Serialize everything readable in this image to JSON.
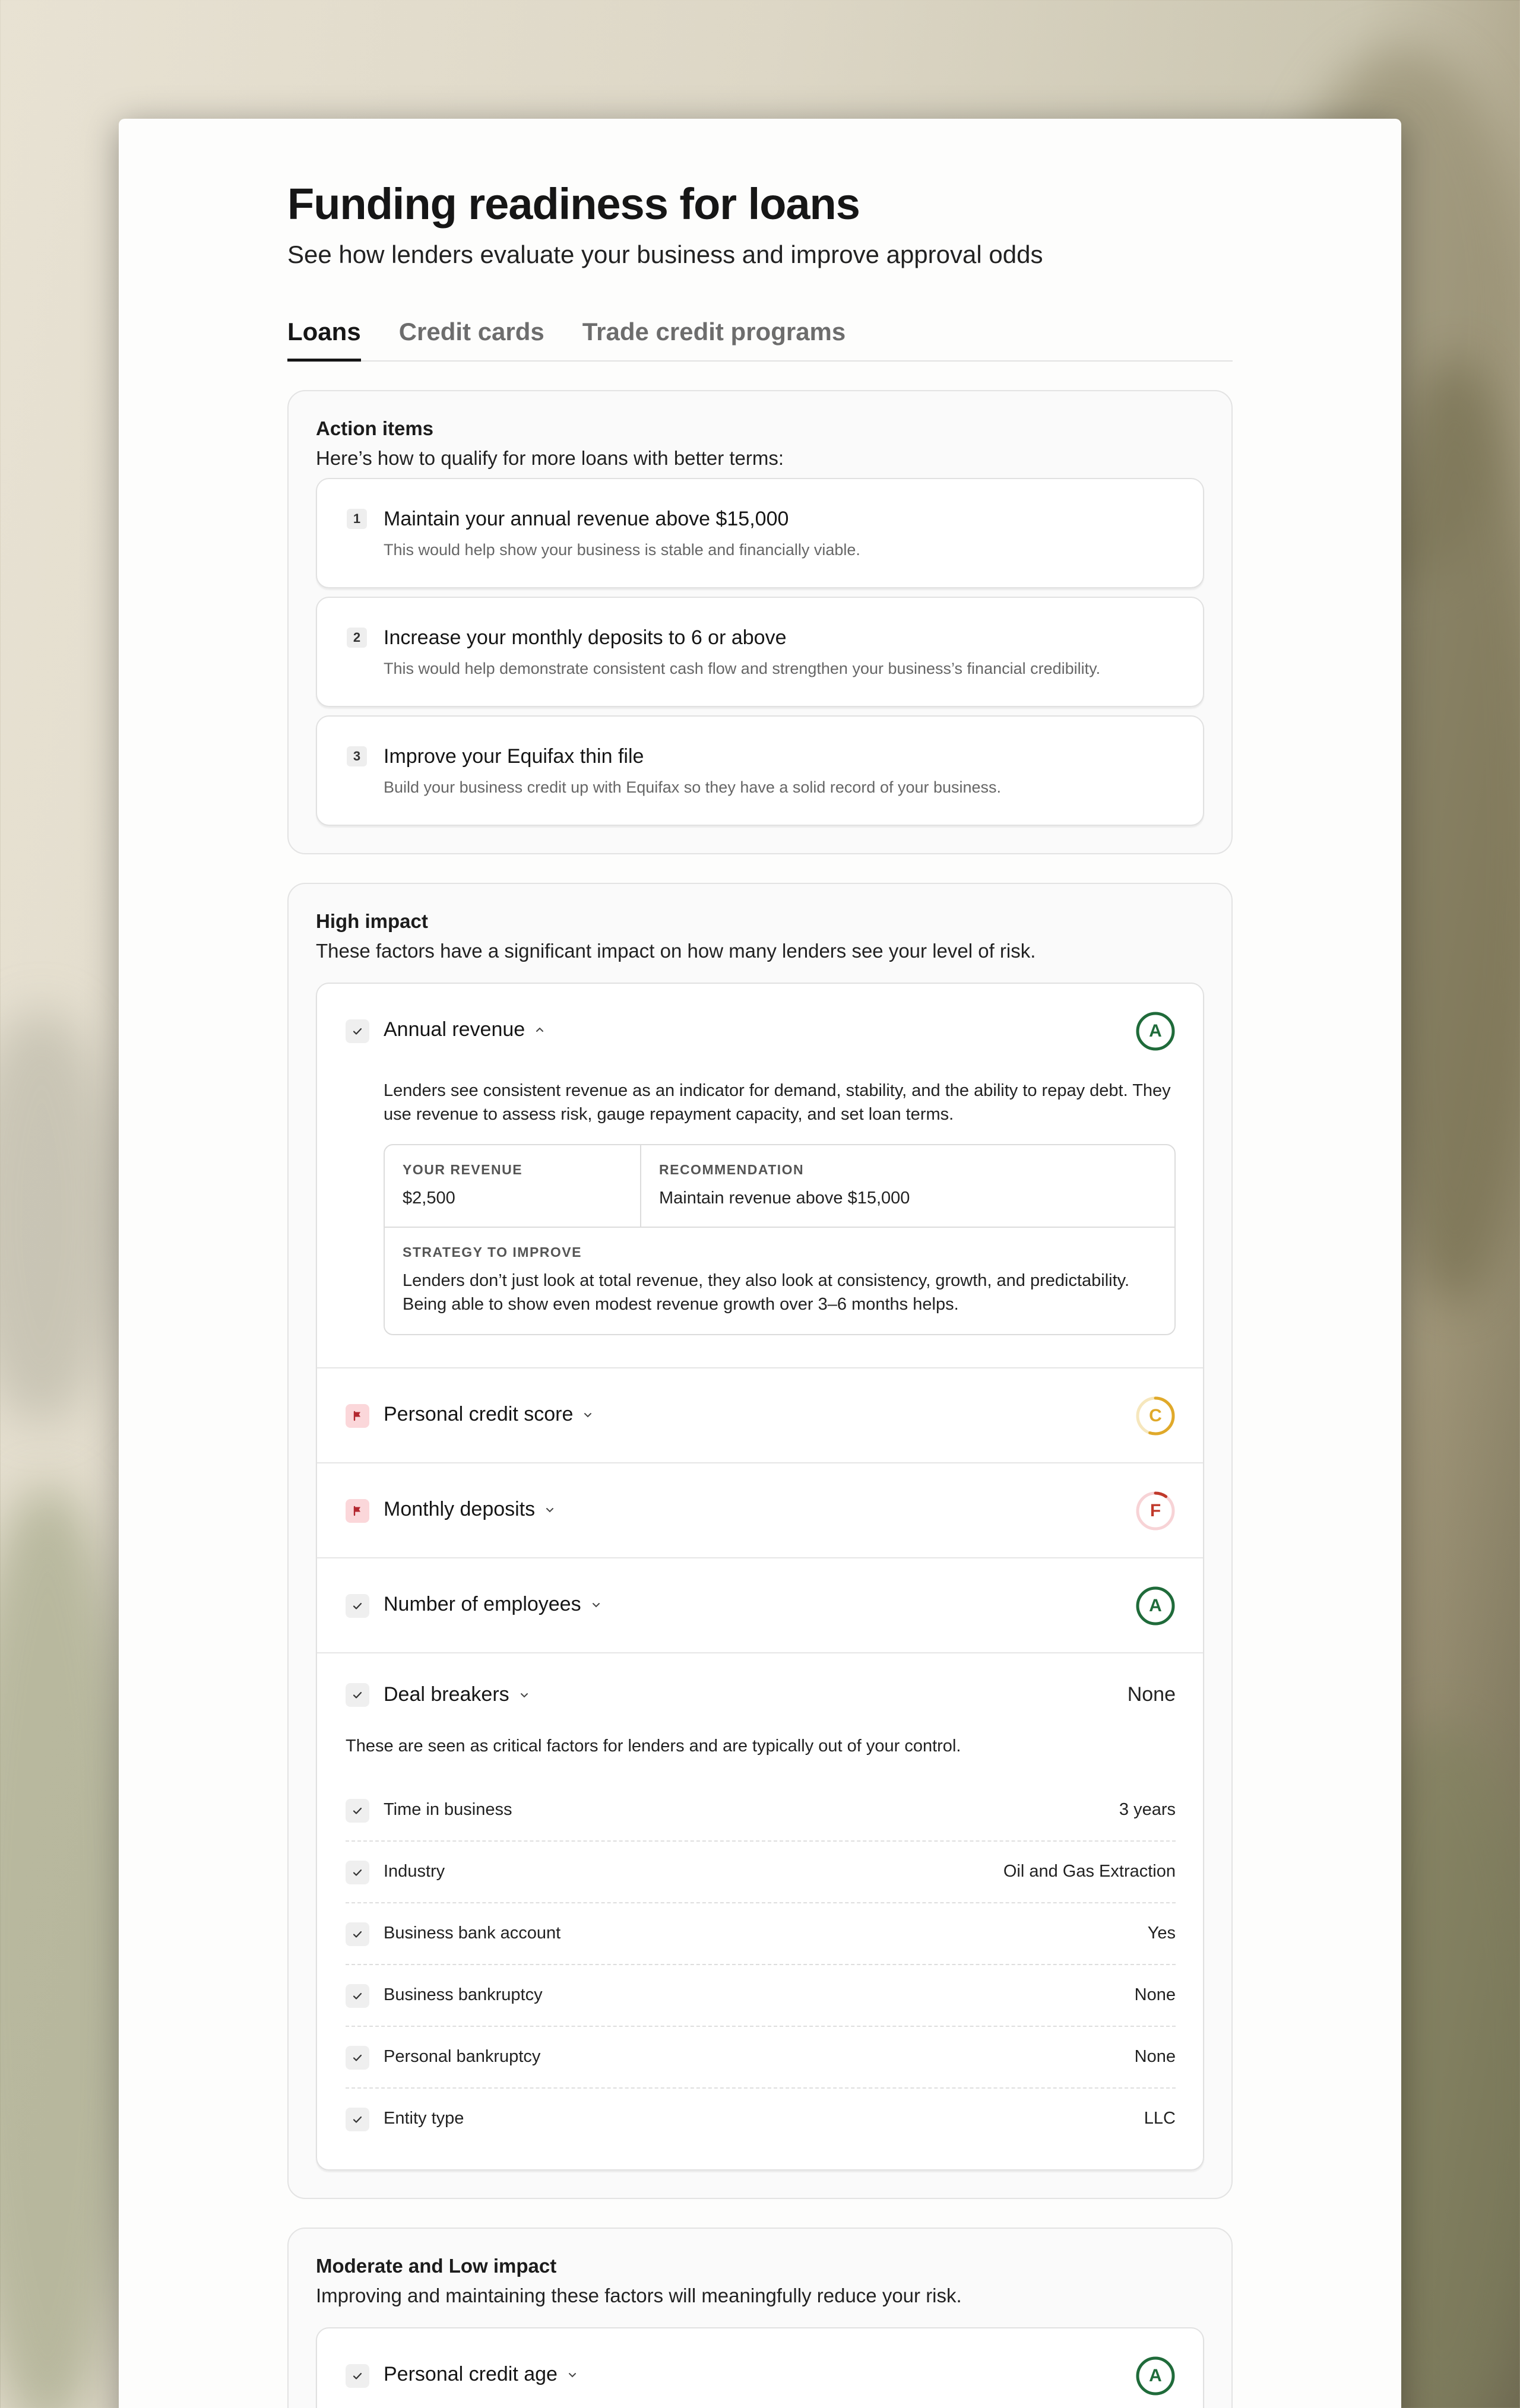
{
  "header": {
    "title": "Funding readiness for loans",
    "subtitle": "See how lenders evaluate your business and improve approval odds"
  },
  "tabs": [
    {
      "label": "Loans",
      "active": true
    },
    {
      "label": "Credit cards",
      "active": false
    },
    {
      "label": "Trade credit programs",
      "active": false
    }
  ],
  "action_items": {
    "title": "Action items",
    "description": "Here’s how to qualify for more loans with better terms:",
    "items": [
      {
        "number": "1",
        "title": "Maintain your annual revenue above $15,000",
        "description": "This would help show your business is stable and financially viable."
      },
      {
        "number": "2",
        "title": "Increase your monthly deposits to 6 or above",
        "description": "This would help demonstrate consistent cash flow and strengthen your business’s financial credibility."
      },
      {
        "number": "3",
        "title": "Improve your Equifax thin file",
        "description": "Build your business credit up with Equifax so they have a solid record of your business."
      }
    ]
  },
  "high_impact": {
    "title": "High impact",
    "description": "These factors have a significant impact on how many lenders see your level of risk.",
    "factors": [
      {
        "label": "Annual revenue",
        "status_icon": "check-icon",
        "grade": "A",
        "grade_color": "#1f6b3a",
        "grade_level": 1.0,
        "expanded": true,
        "detail": "Lenders see consistent revenue as an indicator for demand, stability, and the ability to repay debt. They use revenue to assess risk, gauge repayment capacity, and set loan terms.",
        "your_revenue_label": "YOUR REVENUE",
        "your_revenue_value": "$2,500",
        "recommendation_label": "RECOMMENDATION",
        "recommendation_value": "Maintain revenue above $15,000",
        "strategy_label": "STRATEGY TO IMPROVE",
        "strategy_value": "Lenders don’t just look at total revenue, they also look at consistency, growth, and predictability. Being able to show even modest revenue growth over 3–6 months helps."
      },
      {
        "label": "Personal credit score",
        "status_icon": "flag-icon",
        "grade": "C",
        "grade_color": "#e0a92a",
        "grade_level": 0.55
      },
      {
        "label": "Monthly deposits",
        "status_icon": "flag-icon",
        "grade": "F",
        "grade_color": "#c0392b",
        "grade_level": 0.1
      },
      {
        "label": "Number of employees",
        "status_icon": "check-icon",
        "grade": "A",
        "grade_color": "#1f6b3a",
        "grade_level": 1.0
      }
    ],
    "deal_breakers": {
      "label": "Deal breakers",
      "value": "None",
      "description": "These are seen as critical factors for lenders and are typically out of your control.",
      "rows": [
        {
          "label": "Time in business",
          "value": "3 years"
        },
        {
          "label": "Industry",
          "value": "Oil and Gas Extraction"
        },
        {
          "label": "Business bank account",
          "value": "Yes"
        },
        {
          "label": "Business bankruptcy",
          "value": "None"
        },
        {
          "label": "Personal bankruptcy",
          "value": "None"
        },
        {
          "label": "Entity type",
          "value": "LLC"
        }
      ]
    }
  },
  "moderate_impact": {
    "title": "Moderate and Low impact",
    "description": "Improving and maintaining these factors will meaningfully reduce your risk.",
    "factors": [
      {
        "label": "Personal credit age",
        "status_icon": "check-icon",
        "grade": "A",
        "grade_color": "#1f6b3a",
        "grade_level": 1.0
      }
    ]
  }
}
